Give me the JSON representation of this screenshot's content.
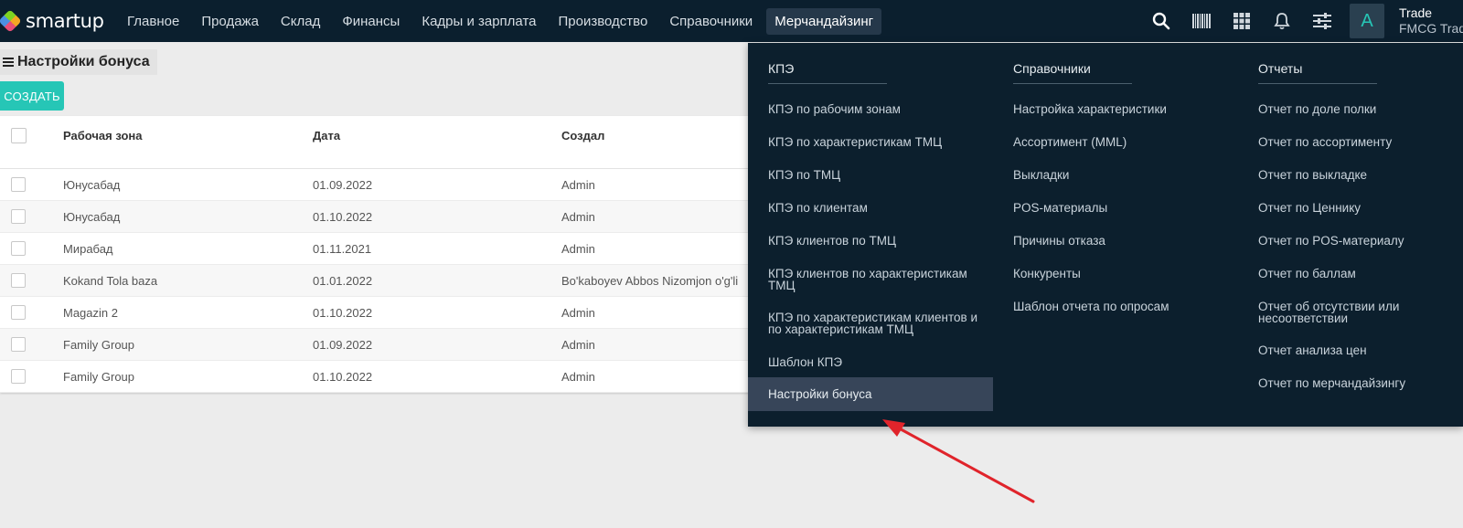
{
  "app": {
    "logo_text": "smartup"
  },
  "nav": {
    "items": [
      "Главное",
      "Продажа",
      "Склад",
      "Финансы",
      "Кадры и зарплата",
      "Производство",
      "Справочники",
      "Мерчандайзинг"
    ],
    "active_index": 7
  },
  "tools": {
    "icons": [
      "search-icon",
      "barcode-icon",
      "grid-icon",
      "bell-icon",
      "sliders-icon"
    ]
  },
  "user": {
    "avatar_letter": "A",
    "name": "Trade",
    "company": "FMCG Trade"
  },
  "page": {
    "title": "Настройки бонуса",
    "create_label": "СОЗДАТЬ"
  },
  "table": {
    "columns": [
      "Рабочая зона",
      "Дата",
      "Создал"
    ],
    "rows": [
      [
        "Юнусабад",
        "01.09.2022",
        "Admin"
      ],
      [
        "Юнусабад",
        "01.10.2022",
        "Admin"
      ],
      [
        "Мирабад",
        "01.11.2021",
        "Admin"
      ],
      [
        "Kokand Tola baza",
        "01.01.2022",
        "Bo'kaboyev Abbos Nizomjon o'g'li"
      ],
      [
        "Magazin 2",
        "01.10.2022",
        "Admin"
      ],
      [
        "Family Group",
        "01.09.2022",
        "Admin"
      ],
      [
        "Family Group",
        "01.10.2022",
        "Admin"
      ]
    ]
  },
  "menu": {
    "columns": [
      {
        "title": "КПЭ",
        "items": [
          "КПЭ по рабочим зонам",
          "КПЭ по характеристикам ТМЦ",
          "КПЭ по ТМЦ",
          "КПЭ по клиентам",
          "КПЭ клиентов по ТМЦ",
          "КПЭ клиентов по характеристикам ТМЦ",
          "КПЭ по характеристикам клиентов и по характеристикам ТМЦ",
          "Шаблон КПЭ",
          "Настройки бонуса"
        ],
        "selected_index": 8
      },
      {
        "title": "Справочники",
        "items": [
          "Настройка характеристики",
          "Ассортимент (MML)",
          "Выкладки",
          "POS-материалы",
          "Причины отказа",
          "Конкуренты",
          "Шаблон отчета по опросам"
        ]
      },
      {
        "title": "Отчеты",
        "items": [
          "Отчет по доле полки",
          "Отчет по ассортименту",
          "Отчет по выкладке",
          "Отчет по Ценнику",
          "Отчет по POS-материалу",
          "Отчет по баллам",
          "Отчет об отсутствии или несоответствии",
          "Отчет анализа цен",
          "Отчет по мерчандайзингу"
        ]
      }
    ]
  },
  "colors": {
    "navbar_bg": "#0b1f2e",
    "accent": "#26c6b6",
    "menu_bg": "#0c1f2d",
    "selected_bg": "#374559",
    "arrow": "#e0242b"
  }
}
